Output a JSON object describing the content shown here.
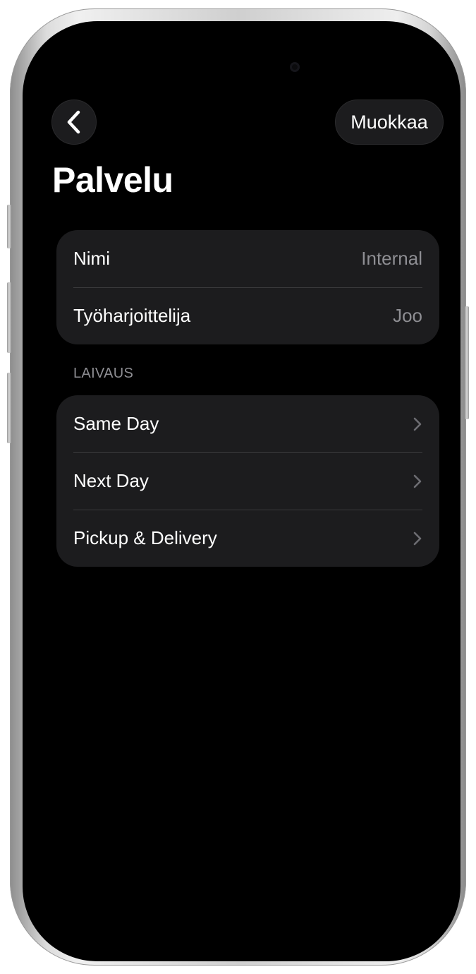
{
  "nav": {
    "back_icon": "chevron-left-icon",
    "edit_label": "Muokkaa"
  },
  "page": {
    "title": "Palvelu"
  },
  "details": [
    {
      "label": "Nimi",
      "value": "Internal"
    },
    {
      "label": "Työharjoittelija",
      "value": "Joo"
    }
  ],
  "shipping": {
    "header": "LAIVAUS",
    "items": [
      {
        "label": "Same Day",
        "icon": "chevron-right-icon"
      },
      {
        "label": "Next Day",
        "icon": "chevron-right-icon"
      },
      {
        "label": "Pickup & Delivery",
        "icon": "chevron-right-icon"
      }
    ]
  },
  "colors": {
    "background": "#000000",
    "card": "#1c1c1e",
    "separator": "#3a3a3c",
    "secondary_text": "#8e8e93",
    "primary_text": "#ffffff"
  }
}
